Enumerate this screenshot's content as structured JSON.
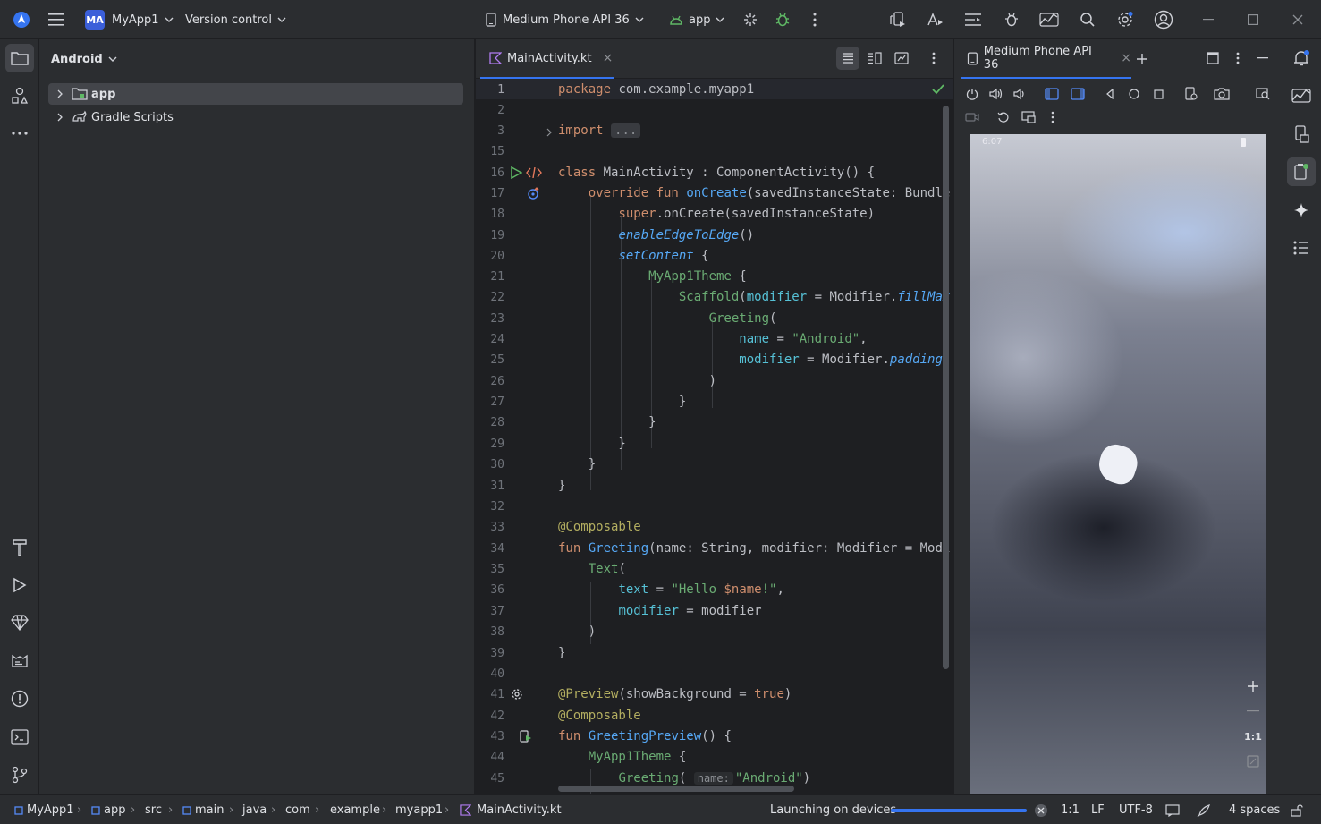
{
  "titlebar": {
    "project_initials": "MA",
    "project_name": "MyApp1",
    "vcs_label": "Version control",
    "device_name": "Medium Phone API 36",
    "run_config": "app"
  },
  "project_panel": {
    "view_mode": "Android",
    "items": [
      {
        "label": "app",
        "selected": true
      },
      {
        "label": "Gradle Scripts",
        "selected": false
      }
    ]
  },
  "editor": {
    "tab_name": "MainActivity.kt",
    "lines": [
      {
        "n": "1",
        "text": "package com.example.myapp1"
      },
      {
        "n": "2",
        "text": ""
      },
      {
        "n": "3",
        "text": "import ..."
      },
      {
        "n": "15",
        "text": ""
      },
      {
        "n": "16",
        "text": "class MainActivity : ComponentActivity() {"
      },
      {
        "n": "17",
        "text": "    override fun onCreate(savedInstanceState: Bundle"
      },
      {
        "n": "18",
        "text": "        super.onCreate(savedInstanceState)"
      },
      {
        "n": "19",
        "text": "        enableEdgeToEdge()"
      },
      {
        "n": "20",
        "text": "        setContent {"
      },
      {
        "n": "21",
        "text": "            MyApp1Theme {"
      },
      {
        "n": "22",
        "text": "                Scaffold(modifier = Modifier.fillMax"
      },
      {
        "n": "23",
        "text": "                    Greeting("
      },
      {
        "n": "24",
        "text": "                        name = \"Android\","
      },
      {
        "n": "25",
        "text": "                        modifier = Modifier.padding("
      },
      {
        "n": "26",
        "text": "                    )"
      },
      {
        "n": "27",
        "text": "                }"
      },
      {
        "n": "28",
        "text": "            }"
      },
      {
        "n": "29",
        "text": "        }"
      },
      {
        "n": "30",
        "text": "    }"
      },
      {
        "n": "31",
        "text": "}"
      },
      {
        "n": "32",
        "text": ""
      },
      {
        "n": "33",
        "text": "@Composable"
      },
      {
        "n": "34",
        "text": "fun Greeting(name: String, modifier: Modifier = Modi"
      },
      {
        "n": "35",
        "text": "    Text("
      },
      {
        "n": "36",
        "text": "        text = \"Hello $name!\","
      },
      {
        "n": "37",
        "text": "        modifier = modifier"
      },
      {
        "n": "38",
        "text": "    )"
      },
      {
        "n": "39",
        "text": "}"
      },
      {
        "n": "40",
        "text": ""
      },
      {
        "n": "41",
        "text": "@Preview(showBackground = true)"
      },
      {
        "n": "42",
        "text": "@Composable"
      },
      {
        "n": "43",
        "text": "fun GreetingPreview() {"
      },
      {
        "n": "44",
        "text": "    MyApp1Theme {"
      },
      {
        "n": "45",
        "text": "        Greeting( name: \"Android\")"
      }
    ],
    "inlay_hint": "name:"
  },
  "devices_panel": {
    "tab_name": "Medium Phone API 36",
    "status_time": "6:07",
    "zoom_fit_label": "1:1"
  },
  "statusbar": {
    "breadcrumbs": [
      "MyApp1",
      "app",
      "src",
      "main",
      "java",
      "com",
      "example",
      "myapp1",
      "MainActivity.kt"
    ],
    "task_text": "Launching on devices",
    "task_progress": 1.0,
    "caret": "1:1",
    "line_sep": "LF",
    "encoding": "UTF-8",
    "indent": "4 spaces"
  },
  "colors": {
    "accent": "#3574f0",
    "background": "#1e1f22",
    "panel": "#2b2d30",
    "keyword": "#cf8e6d",
    "function": "#56a8f5",
    "string": "#6aab73",
    "annotation": "#b3ae60",
    "run_green": "#5fb865"
  },
  "icons": [
    "app-logo-icon",
    "hamburger-menu-icon",
    "device-icon",
    "android-icon",
    "apply-changes-icon",
    "debug-bug-icon",
    "more-vertical-icon",
    "search-icon",
    "settings-icon",
    "account-icon",
    "minimize-icon",
    "maximize-icon",
    "close-icon",
    "folder-icon",
    "structure-icon",
    "notifications-icon",
    "gemini-icon"
  ]
}
